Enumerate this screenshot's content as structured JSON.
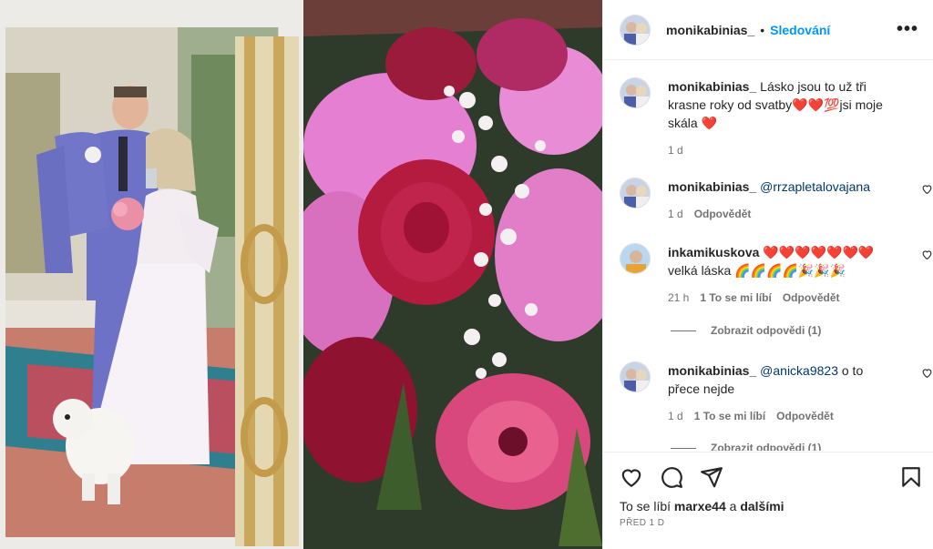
{
  "post": {
    "username": "monikabinias_",
    "separator": "•",
    "follow_label": "Sledování",
    "more_label": "•••"
  },
  "caption": {
    "username": "monikabinias_",
    "text": "Lásko jsou to už tři krasne roky od svatby❤️❤️💯jsi moje skála ❤️",
    "time": "1 d"
  },
  "comments": [
    {
      "username": "monikabinias_",
      "mention": "@rrzapletalovajana",
      "text": "",
      "time": "1 d",
      "likes": "",
      "reply": "Odpovědět"
    },
    {
      "username": "inkamikuskova",
      "mention": "",
      "text": "❤️❤️❤️❤️❤️❤️❤️ velká láska 🌈🌈🌈🌈🎉🎉🎉",
      "time": "21 h",
      "likes": "1 To se mi líbí",
      "reply": "Odpovědět",
      "view_replies": "Zobrazit odpovědi (1)"
    },
    {
      "username": "monikabinias_",
      "mention": "@anicka9823",
      "text": " o to přece nejde",
      "time": "1 d",
      "likes": "1 To se mi líbí",
      "reply": "Odpovědět",
      "view_replies": "Zobrazit odpovědi (1)"
    }
  ],
  "footer": {
    "likes_prefix": "To se líbí",
    "likes_user": "marxe44",
    "likes_join": "a",
    "likes_rest": "dalšími",
    "date": "PŘED 1 D"
  },
  "icons": [
    "like-icon",
    "comment-icon",
    "share-icon",
    "save-icon"
  ],
  "colors": {
    "accent": "#0095f6",
    "text": "#262626",
    "muted": "#737373",
    "mention": "#00376b"
  }
}
